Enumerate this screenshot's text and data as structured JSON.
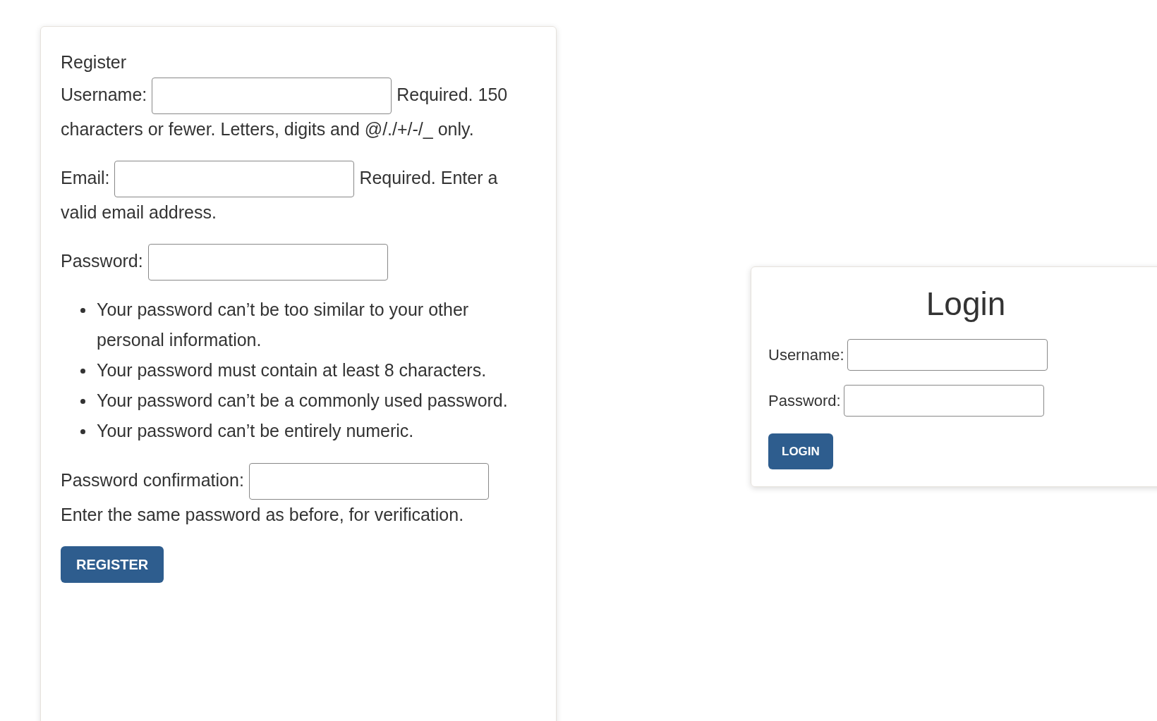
{
  "register": {
    "title": "Register",
    "fields": [
      {
        "label": "Username:",
        "help": "Required. 150",
        "help_more": "characters or fewer. Letters, digits and @/./+/-/_ only."
      },
      {
        "label": "Email:",
        "help": "Required. Enter a",
        "help_more": "valid email address."
      },
      {
        "label": "Password:",
        "help_items": [
          "Your password can’t be too similar to your other personal information.",
          "Your password must contain at least 8 characters.",
          "Your password can’t be a commonly used password.",
          "Your password can’t be entirely numeric."
        ]
      },
      {
        "label": "Password confirmation:",
        "help_more": "Enter the same password as before, for verification."
      }
    ],
    "button": "REGISTER"
  },
  "login": {
    "title": "Login",
    "fields": [
      {
        "label": "Username:"
      },
      {
        "label": "Password:"
      }
    ],
    "button": "LOGIN"
  }
}
